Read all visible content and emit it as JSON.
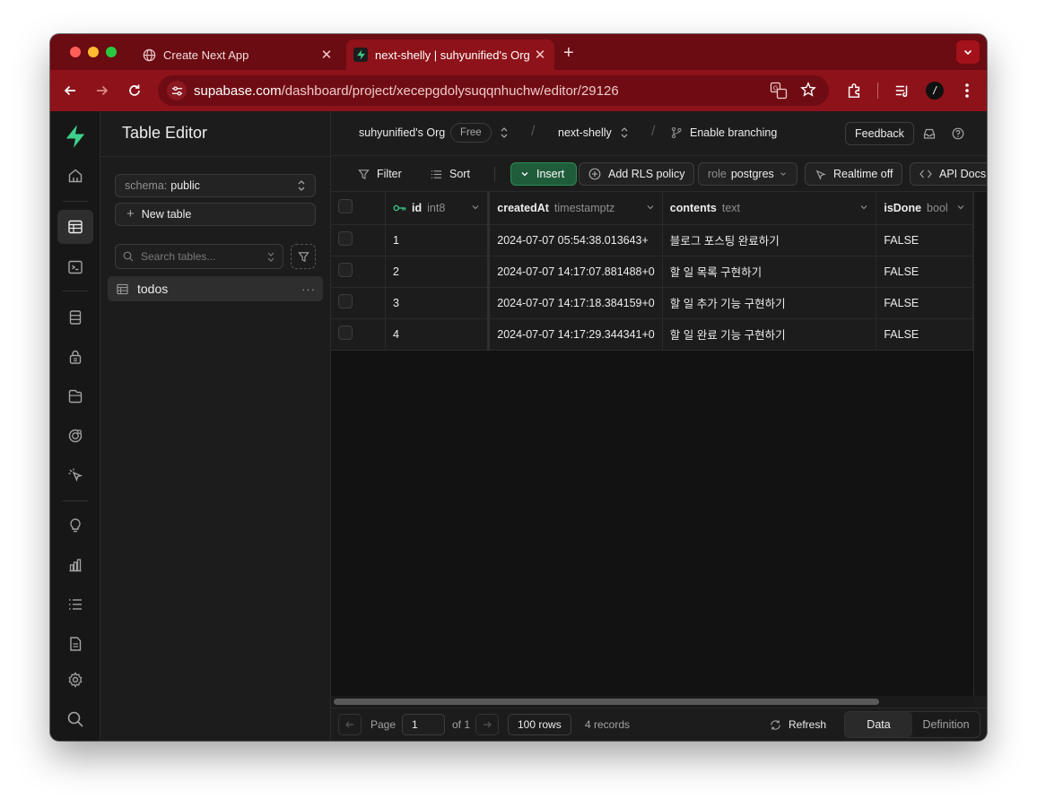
{
  "browser": {
    "tabs": [
      {
        "title": "Create Next App",
        "active": false
      },
      {
        "title": "next-shelly | suhyunified's Org",
        "active": true
      }
    ],
    "url_host": "supabase.com",
    "url_path": "/dashboard/project/xecepgdolysuqqnhuchw/editor/29126"
  },
  "sidebar": {
    "title": "Table Editor",
    "schema_label": "schema:",
    "schema_value": "public",
    "new_table": "New table",
    "search_placeholder": "Search tables...",
    "tables": [
      {
        "name": "todos"
      }
    ],
    "more": "···"
  },
  "topbar": {
    "org": "suhyunified's Org",
    "plan": "Free",
    "project": "next-shelly",
    "branching": "Enable branching",
    "feedback": "Feedback"
  },
  "actions": {
    "filter": "Filter",
    "sort": "Sort",
    "insert": "Insert",
    "rls": "Add RLS policy",
    "role_label": "role",
    "role_value": "postgres",
    "realtime": "Realtime off",
    "api_docs": "API Docs"
  },
  "grid": {
    "columns": [
      {
        "name": "id",
        "type": "int8"
      },
      {
        "name": "createdAt",
        "type": "timestamptz"
      },
      {
        "name": "contents",
        "type": "text"
      },
      {
        "name": "isDone",
        "type": "bool"
      }
    ],
    "rows": [
      {
        "id": "1",
        "createdAt": "2024-07-07 05:54:38.013643+",
        "contents": "블로그 포스팅 완료하기",
        "isDone": "FALSE"
      },
      {
        "id": "2",
        "createdAt": "2024-07-07 14:17:07.881488+0",
        "contents": "할 일 목록 구현하기",
        "isDone": "FALSE"
      },
      {
        "id": "3",
        "createdAt": "2024-07-07 14:17:18.384159+0",
        "contents": "할 일 추가 기능 구현하기",
        "isDone": "FALSE"
      },
      {
        "id": "4",
        "createdAt": "2024-07-07 14:17:29.344341+0",
        "contents": "할 일 완료 기능 구현하기",
        "isDone": "FALSE"
      }
    ]
  },
  "footer": {
    "page_label": "Page",
    "page_value": "1",
    "of_label": "of 1",
    "rows_label": "100 rows",
    "records": "4 records",
    "refresh": "Refresh",
    "data_tab": "Data",
    "definition_tab": "Definition"
  },
  "colors": {
    "brand_green": "#3ecf8e",
    "browser_red": "#8e1219"
  }
}
